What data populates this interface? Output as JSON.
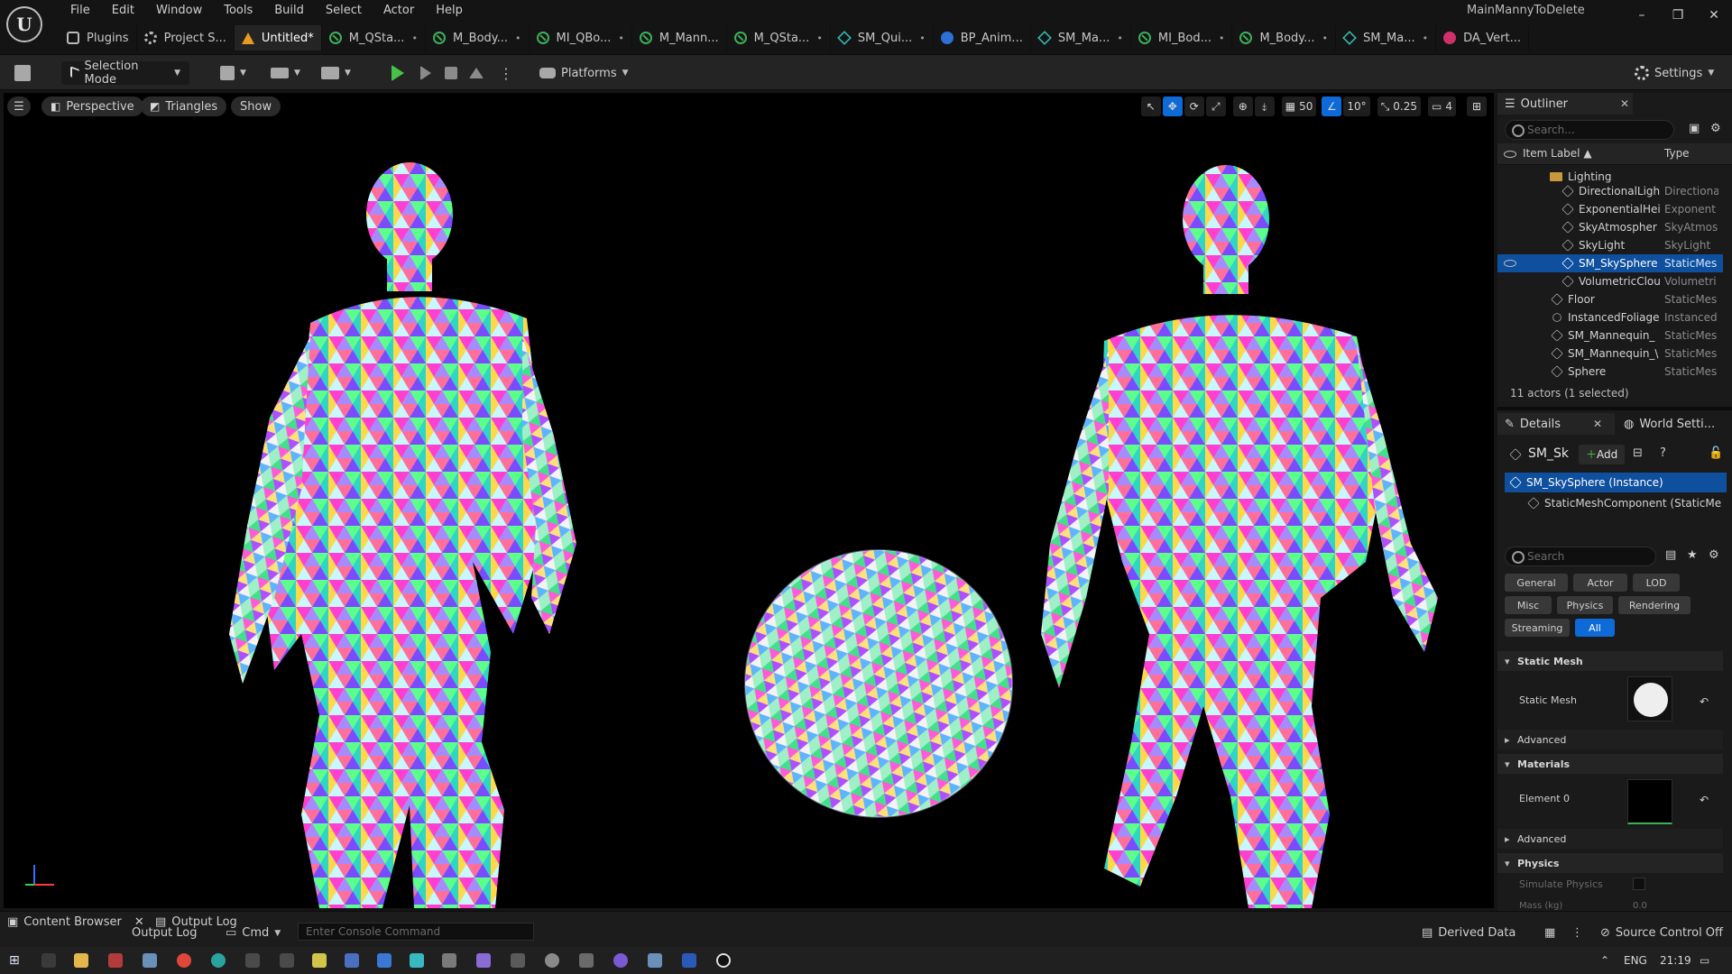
{
  "window": {
    "title": "MainMannyToDelete",
    "menu": [
      "File",
      "Edit",
      "Window",
      "Tools",
      "Build",
      "Select",
      "Actor",
      "Help"
    ],
    "controls": [
      "–",
      "❐",
      "✕"
    ]
  },
  "tabs": [
    {
      "label": "Plugins",
      "icon": "plugin-icon",
      "modified": ""
    },
    {
      "label": "Project S...",
      "icon": "gear-icon",
      "modified": ""
    },
    {
      "label": "Untitled*",
      "icon": "level-icon",
      "modified": ""
    },
    {
      "label": "M_QSta...",
      "icon": "material-icon",
      "modified": "•"
    },
    {
      "label": "M_Body...",
      "icon": "material-icon",
      "modified": "•"
    },
    {
      "label": "MI_QBo...",
      "icon": "material-instance-icon",
      "modified": "•"
    },
    {
      "label": "M_Mann...",
      "icon": "material-icon",
      "modified": ""
    },
    {
      "label": "M_QSta...",
      "icon": "material-instance-icon",
      "modified": "•"
    },
    {
      "label": "SM_Qui...",
      "icon": "static-mesh-icon",
      "modified": "•"
    },
    {
      "label": "BP_Anim...",
      "icon": "blueprint-icon",
      "modified": ""
    },
    {
      "label": "SM_Ma...",
      "icon": "static-mesh-icon",
      "modified": "•"
    },
    {
      "label": "MI_Bod...",
      "icon": "material-instance-icon",
      "modified": "•"
    },
    {
      "label": "M_Body...",
      "icon": "material-icon",
      "modified": "•"
    },
    {
      "label": "SM_Ma...",
      "icon": "static-mesh-icon",
      "modified": "•"
    },
    {
      "label": "DA_Vert...",
      "icon": "data-asset-icon",
      "modified": ""
    }
  ],
  "toolbar": {
    "selection_mode": "Selection Mode",
    "platforms": "Platforms",
    "settings": "Settings"
  },
  "viewport": {
    "perspective": "Perspective",
    "view_mode": "Triangles",
    "show": "Show",
    "grid_snap": "50",
    "rotation_snap": "10°",
    "scale_snap": "0.25",
    "camera_speed": "4"
  },
  "outliner": {
    "tab": "Outliner",
    "search_placeholder": "Search...",
    "col_label": "Item Label",
    "col_type": "Type",
    "rows": [
      {
        "label": "Lighting",
        "type": ""
      },
      {
        "label": "DirectionalLigh",
        "type": "Directiona"
      },
      {
        "label": "ExponentialHei",
        "type": "Exponent"
      },
      {
        "label": "SkyAtmospher",
        "type": "SkyAtmos"
      },
      {
        "label": "SkyLight",
        "type": "SkyLight"
      },
      {
        "label": "SM_SkySphere",
        "type": "StaticMes"
      },
      {
        "label": "VolumetricClou",
        "type": "Volumetri"
      },
      {
        "label": "Floor",
        "type": "StaticMes"
      },
      {
        "label": "InstancedFoliage",
        "type": "Instanced"
      },
      {
        "label": "SM_Mannequin_",
        "type": "StaticMes"
      },
      {
        "label": "SM_Mannequin_\\",
        "type": "StaticMes"
      },
      {
        "label": "Sphere",
        "type": "StaticMes"
      }
    ],
    "count": "11 actors (1 selected)"
  },
  "details": {
    "tab": "Details",
    "world_tab": "World Setti...",
    "object_name": "SM_Sk",
    "add_label": "Add",
    "instance": "SM_SkySphere (Instance)",
    "component": "StaticMeshComponent (StaticMe",
    "search_placeholder": "Search",
    "filters": [
      "General",
      "Actor",
      "LOD",
      "Misc",
      "Physics",
      "Rendering",
      "Streaming",
      "All"
    ],
    "sections": {
      "static_mesh": "Static Mesh",
      "static_mesh_prop": "Static Mesh",
      "advanced": "Advanced",
      "materials": "Materials",
      "element0": "Element 0",
      "advanced2": "Advanced",
      "physics": "Physics",
      "simulate": "Simulate Physics",
      "mass": "Mass (kg)",
      "mass_value": "0.0"
    }
  },
  "status": {
    "content_browser": "Content Browser",
    "output_log_tab": "Output Log",
    "output_log": "Output Log",
    "cmd": "Cmd",
    "console_placeholder": "Enter Console Command",
    "derived_data": "Derived Data",
    "source_control": "Source Control Off"
  },
  "taskbar": {
    "lang": "ENG",
    "time": "21:19"
  },
  "colors": {
    "accent": "#0e6ad6",
    "selected": "#0e4f9e"
  }
}
